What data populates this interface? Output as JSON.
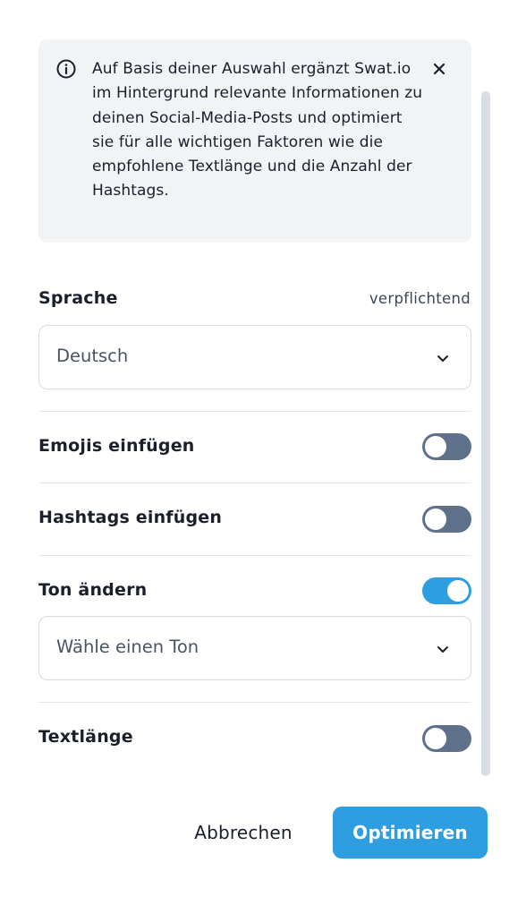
{
  "info": {
    "text": "Auf Basis deiner Auswahl ergänzt Swat.io im Hintergrund relevante Informationen zu deinen Social-Media-Posts und optimiert sie für alle wichtigen Faktoren wie die empfohlene Textlänge und die Anzahl der Hashtags.",
    "icon": "info-circle-icon",
    "close_icon": "close-icon"
  },
  "language": {
    "label": "Sprache",
    "required_label": "verpflichtend",
    "selected": "Deutsch"
  },
  "options": {
    "emojis": {
      "label": "Emojis einfügen",
      "enabled": false
    },
    "hashtags": {
      "label": "Hashtags einfügen",
      "enabled": false
    },
    "tone": {
      "label": "Ton ändern",
      "enabled": true,
      "placeholder": "Wähle einen Ton"
    },
    "text_length": {
      "label": "Textlänge",
      "enabled": false
    }
  },
  "footer": {
    "cancel_label": "Abbrechen",
    "submit_label": "Optimieren"
  },
  "colors": {
    "accent": "#2f9ee0",
    "toggle_off": "#5f708b",
    "info_bg": "#f2f3f5",
    "text": "#1a1f2b"
  }
}
